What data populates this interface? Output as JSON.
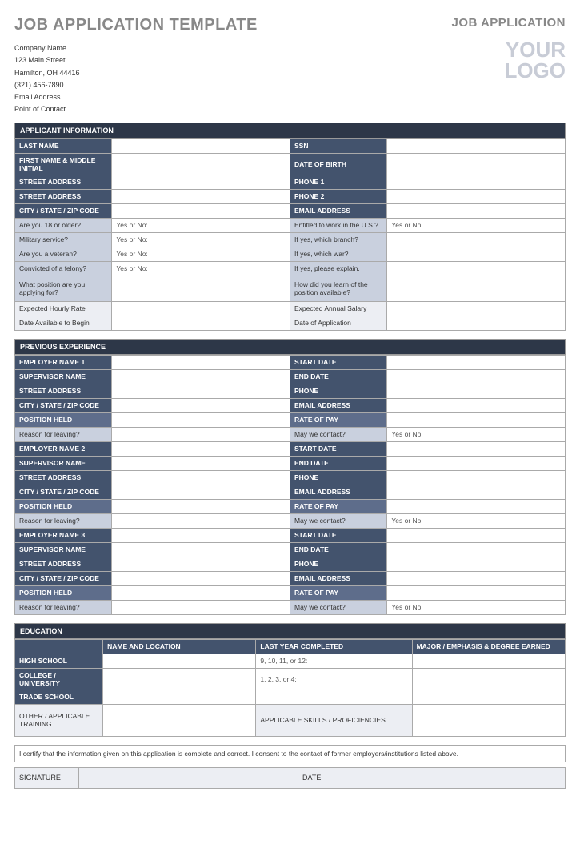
{
  "title": "JOB APPLICATION TEMPLATE",
  "company": {
    "name": "Company Name",
    "street": "123 Main Street",
    "city": "Hamilton, OH 44416",
    "phone": "(321) 456-7890",
    "email": "Email Address",
    "contact": "Point of Contact"
  },
  "headerRight": {
    "jobApp": "JOB APPLICATION",
    "logo1": "YOUR",
    "logo2": "LOGO"
  },
  "sections": {
    "applicant": "APPLICANT INFORMATION",
    "previous": "PREVIOUS EXPERIENCE",
    "education": "EDUCATION"
  },
  "labels": {
    "lastName": "LAST NAME",
    "ssn": "SSN",
    "firstMiddle": "FIRST NAME & MIDDLE INITIAL",
    "dob": "DATE OF BIRTH",
    "street": "STREET ADDRESS",
    "phone1": "PHONE 1",
    "phone2": "PHONE 2",
    "cityStateZip": "CITY / STATE / ZIP CODE",
    "emailAddr": "EMAIL ADDRESS",
    "over18": "Are you 18 or older?",
    "entitled": "Entitled to work in the U.S.?",
    "military": "Military service?",
    "branch": "If yes, which branch?",
    "veteran": "Are you a veteran?",
    "war": "If yes, which war?",
    "felony": "Convicted of a felony?",
    "explain": "If yes, please explain.",
    "position": "What position are you applying for?",
    "learn": "How did you learn of the position available?",
    "hourly": "Expected Hourly Rate",
    "annual": "Expected Annual Salary",
    "dateBegin": "Date Available to Begin",
    "dateApp": "Date of Application",
    "yesNo": "Yes or No:",
    "emp1": "EMPLOYER NAME 1",
    "emp2": "EMPLOYER NAME 2",
    "emp3": "EMPLOYER NAME 3",
    "supervisor": "SUPERVISOR NAME",
    "startDate": "START DATE",
    "endDate": "END DATE",
    "phone": "PHONE",
    "positionHeld": "POSITION HELD",
    "rateOfPay": "RATE OF PAY",
    "reasonLeaving": "Reason for leaving?",
    "mayContact": "May we contact?",
    "nameLocation": "NAME AND LOCATION",
    "lastYear": "LAST YEAR COMPLETED",
    "major": "MAJOR / EMPHASIS & DEGREE EARNED",
    "highSchool": "HIGH SCHOOL",
    "college": "COLLEGE / UNIVERSITY",
    "trade": "TRADE SCHOOL",
    "other": "OTHER / APPLICABLE TRAINING",
    "skills": "APPLICABLE SKILLS / PROFICIENCIES",
    "hsYears": "9, 10, 11, or 12:",
    "colYears": "1, 2, 3, or 4:",
    "cert": "I certify that the information given on this application is complete and correct. I consent to the contact of former employers/institutions listed above.",
    "signature": "SIGNATURE",
    "date": "DATE"
  }
}
